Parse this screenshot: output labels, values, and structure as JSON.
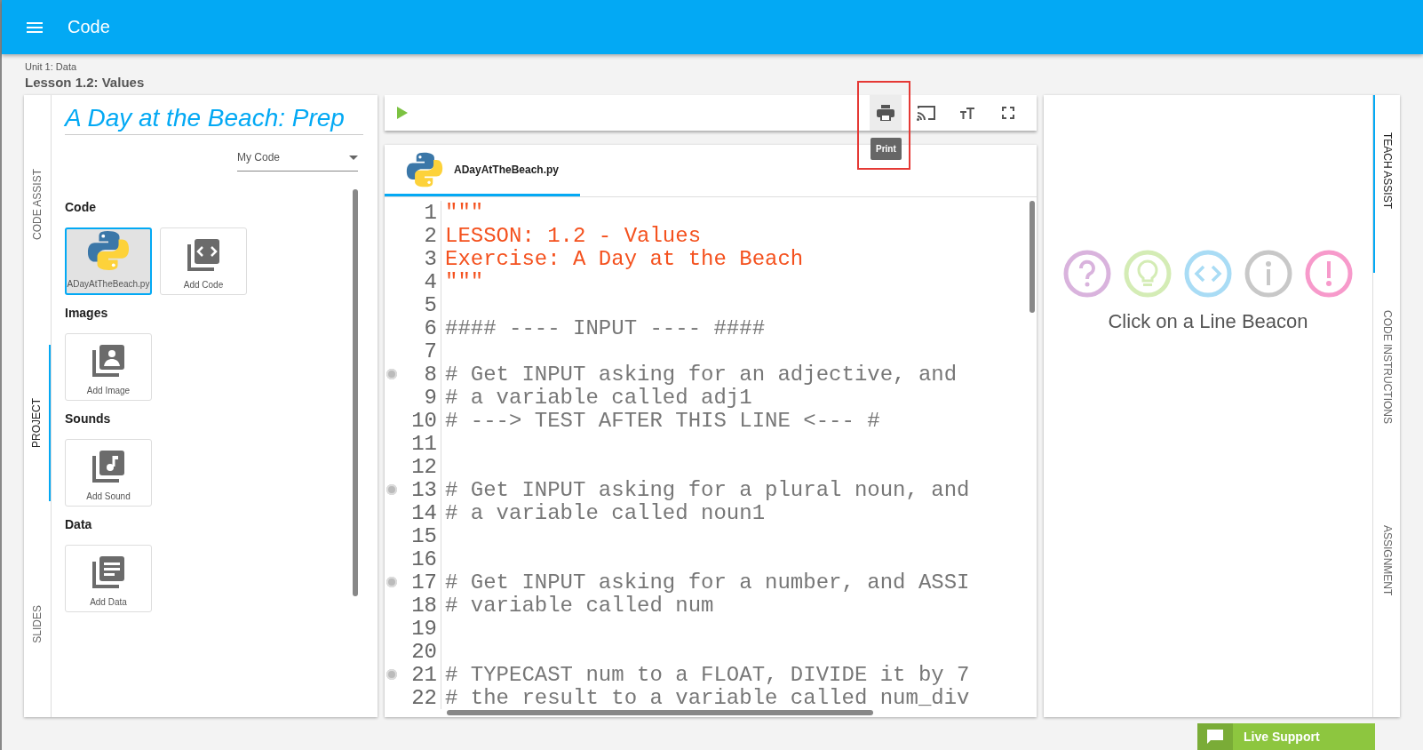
{
  "app_bar": {
    "title": "Code"
  },
  "breadcrumb": {
    "unit": "Unit 1: Data",
    "lesson": "Lesson 1.2: Values"
  },
  "left_tabs": [
    {
      "label": "CODE ASSIST",
      "selected": false
    },
    {
      "label": "PROJECT",
      "selected": true
    },
    {
      "label": "SLIDES",
      "selected": false
    }
  ],
  "project": {
    "title": "A Day at the Beach: Prep",
    "dropdown": {
      "value": "My Code"
    },
    "sections": [
      {
        "heading": "Code",
        "tiles": [
          {
            "kind": "python",
            "label": "ADayAtTheBeach.py",
            "selected": true
          },
          {
            "kind": "code",
            "label": "Add Code",
            "selected": false
          }
        ]
      },
      {
        "heading": "Images",
        "tiles": [
          {
            "kind": "image",
            "label": "Add Image",
            "selected": false
          }
        ]
      },
      {
        "heading": "Sounds",
        "tiles": [
          {
            "kind": "sound",
            "label": "Add Sound",
            "selected": false
          }
        ]
      },
      {
        "heading": "Data",
        "tiles": [
          {
            "kind": "data",
            "label": "Add Data",
            "selected": false
          }
        ]
      }
    ]
  },
  "toolbar": {
    "tooltip": "Print"
  },
  "editor": {
    "file_tab": {
      "label": "ADayAtTheBeach.py",
      "selected": true
    },
    "lines": [
      {
        "n": "1",
        "kind": "string",
        "text": "\"\"\"",
        "beacon": false
      },
      {
        "n": "2",
        "kind": "string",
        "text": "LESSON: 1.2 - Values",
        "beacon": false
      },
      {
        "n": "3",
        "kind": "string",
        "text": "Exercise: A Day at the Beach",
        "beacon": false
      },
      {
        "n": "4",
        "kind": "string",
        "text": "\"\"\"",
        "beacon": false
      },
      {
        "n": "5",
        "beacon": false
      },
      {
        "n": "6",
        "kind": "comment",
        "text": "#### ---- INPUT ---- ####",
        "beacon": false
      },
      {
        "n": "7",
        "beacon": false
      },
      {
        "n": "8",
        "kind": "comment",
        "text": "# Get INPUT asking for an adjective, and",
        "beacon": true
      },
      {
        "n": "9",
        "kind": "comment",
        "text": "# a variable called adj1",
        "beacon": false
      },
      {
        "n": "10",
        "kind": "comment",
        "text": "# ---> TEST AFTER THIS LINE <--- #",
        "beacon": false
      },
      {
        "n": "11",
        "beacon": false
      },
      {
        "n": "12",
        "beacon": false
      },
      {
        "n": "13",
        "kind": "comment",
        "text": "# Get INPUT asking for a plural noun, and",
        "beacon": true
      },
      {
        "n": "14",
        "kind": "comment",
        "text": "# a variable called noun1",
        "beacon": false
      },
      {
        "n": "15",
        "beacon": false
      },
      {
        "n": "16",
        "beacon": false
      },
      {
        "n": "17",
        "kind": "comment",
        "text": "# Get INPUT asking for a number, and ASSI",
        "beacon": true
      },
      {
        "n": "18",
        "kind": "comment",
        "text": "# variable called num",
        "beacon": false
      },
      {
        "n": "19",
        "beacon": false
      },
      {
        "n": "20",
        "beacon": false
      },
      {
        "n": "21",
        "kind": "comment",
        "text": "# TYPECAST num to a FLOAT, DIVIDE it by 7",
        "beacon": true
      },
      {
        "n": "22",
        "kind": "comment",
        "text": "# the result to a variable called num_div",
        "beacon": false
      }
    ]
  },
  "teach_assist": {
    "beacons": [
      {
        "kind": "question",
        "color": "#d9b3dd"
      },
      {
        "kind": "hint",
        "color": "#d4ecb5"
      },
      {
        "kind": "code",
        "color": "#a9dcf5"
      },
      {
        "kind": "info",
        "color": "#c8c8c8"
      },
      {
        "kind": "alert",
        "color": "#f79acb"
      }
    ],
    "message": "Click on a Line Beacon"
  },
  "right_tabs": [
    {
      "label": "TEACH ASSIST",
      "selected": true
    },
    {
      "label": "CODE INSTRUCTIONS",
      "selected": false
    },
    {
      "label": "ASSIGNMENT",
      "selected": false
    }
  ],
  "live_support": {
    "label": "Live Support"
  }
}
